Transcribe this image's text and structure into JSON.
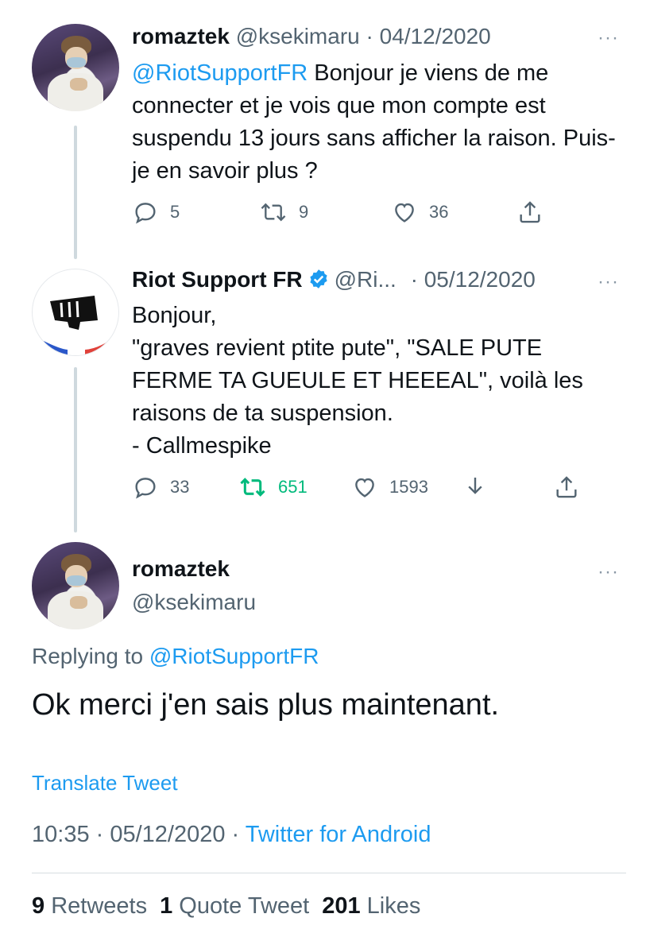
{
  "tweet1": {
    "name": "romaztek",
    "handle": "@ksekimaru",
    "date": "· 04/12/2020",
    "more": "···",
    "mention": "@RiotSupportFR",
    "text": " Bonjour je viens de me connecter et je vois que mon compte est suspendu 13 jours sans afficher la raison. Puis-je en savoir plus ?",
    "replies": "5",
    "retweets": "9",
    "likes": "36"
  },
  "tweet2": {
    "name": "Riot Support FR",
    "handle": "@Ri...",
    "date": "· 05/12/2020",
    "more": "···",
    "lines": [
      "Bonjour,",
      "\"graves revient ptite pute\", \"SALE PUTE",
      "FERME TA GUEULE ET HEEEAL\", voilà les",
      "raisons de ta suspension.",
      "- Callmespike"
    ],
    "replies": "33",
    "retweets": "651",
    "likes": "1593"
  },
  "main_tweet": {
    "name": "romaztek",
    "handle": "@ksekimaru",
    "more": "···",
    "replying_prefix": "Replying to ",
    "replying_to": "@RiotSupportFR",
    "text": "Ok merci j'en sais plus maintenant.",
    "translate": "Translate Tweet",
    "time": "10:35 · 05/12/2020 · ",
    "source": "Twitter for Android",
    "retweets_count": "9",
    "retweets_label": " Retweets",
    "quotes_count": "1",
    "quotes_label": " Quote Tweet",
    "likes_count": "201",
    "likes_label": " Likes"
  },
  "colors": {
    "accent": "#1d9bf0",
    "muted": "#536471",
    "retweet_active": "#00ba7c",
    "text": "#0f1419"
  },
  "icons": [
    "reply-icon",
    "retweet-icon",
    "like-icon",
    "share-icon",
    "download-icon",
    "verified-badge-icon",
    "more-icon"
  ]
}
